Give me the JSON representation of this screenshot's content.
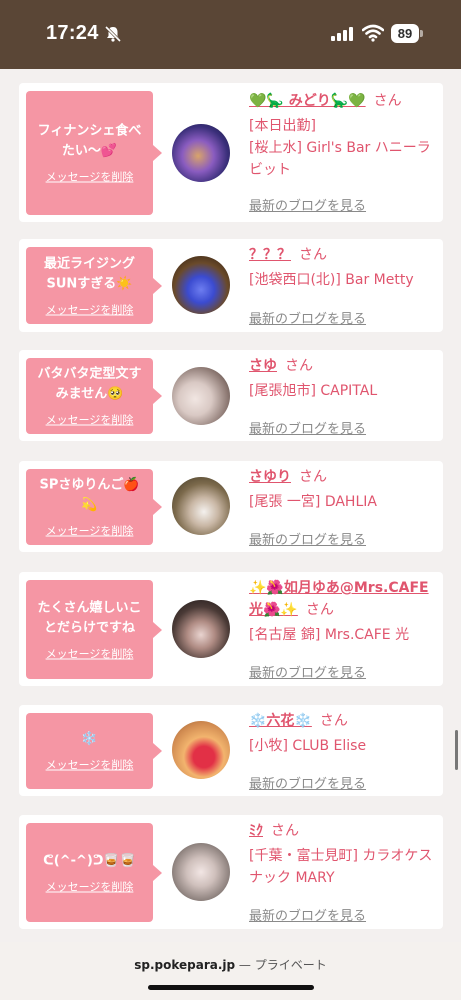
{
  "status_bar": {
    "time": "17:24",
    "battery": "89",
    "icons": [
      "bell-slash-icon",
      "cellular-signal-icon",
      "wifi-icon",
      "battery-icon"
    ]
  },
  "url_bar": {
    "domain": "sp.pokepara.jp",
    "separator": " — ",
    "mode": "プライベート"
  },
  "colors": {
    "status_bar_bg": "#5a4636",
    "bubble_pink": "#f596a4",
    "accent_pink": "#e0556e",
    "link_gray": "#8a8a8a"
  },
  "messages": [
    {
      "message": "フィナンシェ食べたい〜💕",
      "delete_label": "メッセージを削除",
      "name": "💚🦕 みどり🦕💚",
      "honorific": "さん",
      "shop_lines": [
        "[本日出勤]",
        "[桜上水] Girl's Bar ハニーラビット"
      ],
      "blog_label": "最新のブログを見る"
    },
    {
      "message": "最近ライジングSUNすぎる☀️",
      "delete_label": "メッセージを削除",
      "name": "？？？",
      "honorific": "さん",
      "shop_lines": [
        "[池袋西口(北)] Bar Metty"
      ],
      "blog_label": "最新のブログを見る"
    },
    {
      "message": "バタバタ定型文すみません🥺",
      "delete_label": "メッセージを削除",
      "name": "さゆ",
      "honorific": "さん",
      "shop_lines": [
        "[尾張旭市] CAPITAL"
      ],
      "blog_label": "最新のブログを見る"
    },
    {
      "message": "SPさゆりんご🍎💫",
      "delete_label": "メッセージを削除",
      "name": "さゆり",
      "honorific": "さん",
      "shop_lines": [
        "[尾張 一宮] DAHLIA"
      ],
      "blog_label": "最新のブログを見る"
    },
    {
      "message": "たくさん嬉しいことだらけですね",
      "delete_label": "メッセージを削除",
      "name": "✨🌺如月ゆあ@Mrs.CAFE光🌺✨",
      "honorific": "さん",
      "shop_lines": [
        "[名古屋 錦] Mrs.CAFE 光"
      ],
      "blog_label": "最新のブログを見る"
    },
    {
      "message": "❄️",
      "delete_label": "メッセージを削除",
      "name": "❄️六花❄️",
      "honorific": "さん",
      "shop_lines": [
        "[小牧] CLUB Elise"
      ],
      "blog_label": "最新のブログを見る"
    },
    {
      "message": "ᕦ(^-^)ᕤ🥃🥃",
      "delete_label": "メッセージを削除",
      "name": "ﾐｸ",
      "honorific": "さん",
      "shop_lines": [
        "[千葉・富士見町] カラオケスナック MARY"
      ],
      "blog_label": "最新のブログを見る"
    }
  ]
}
